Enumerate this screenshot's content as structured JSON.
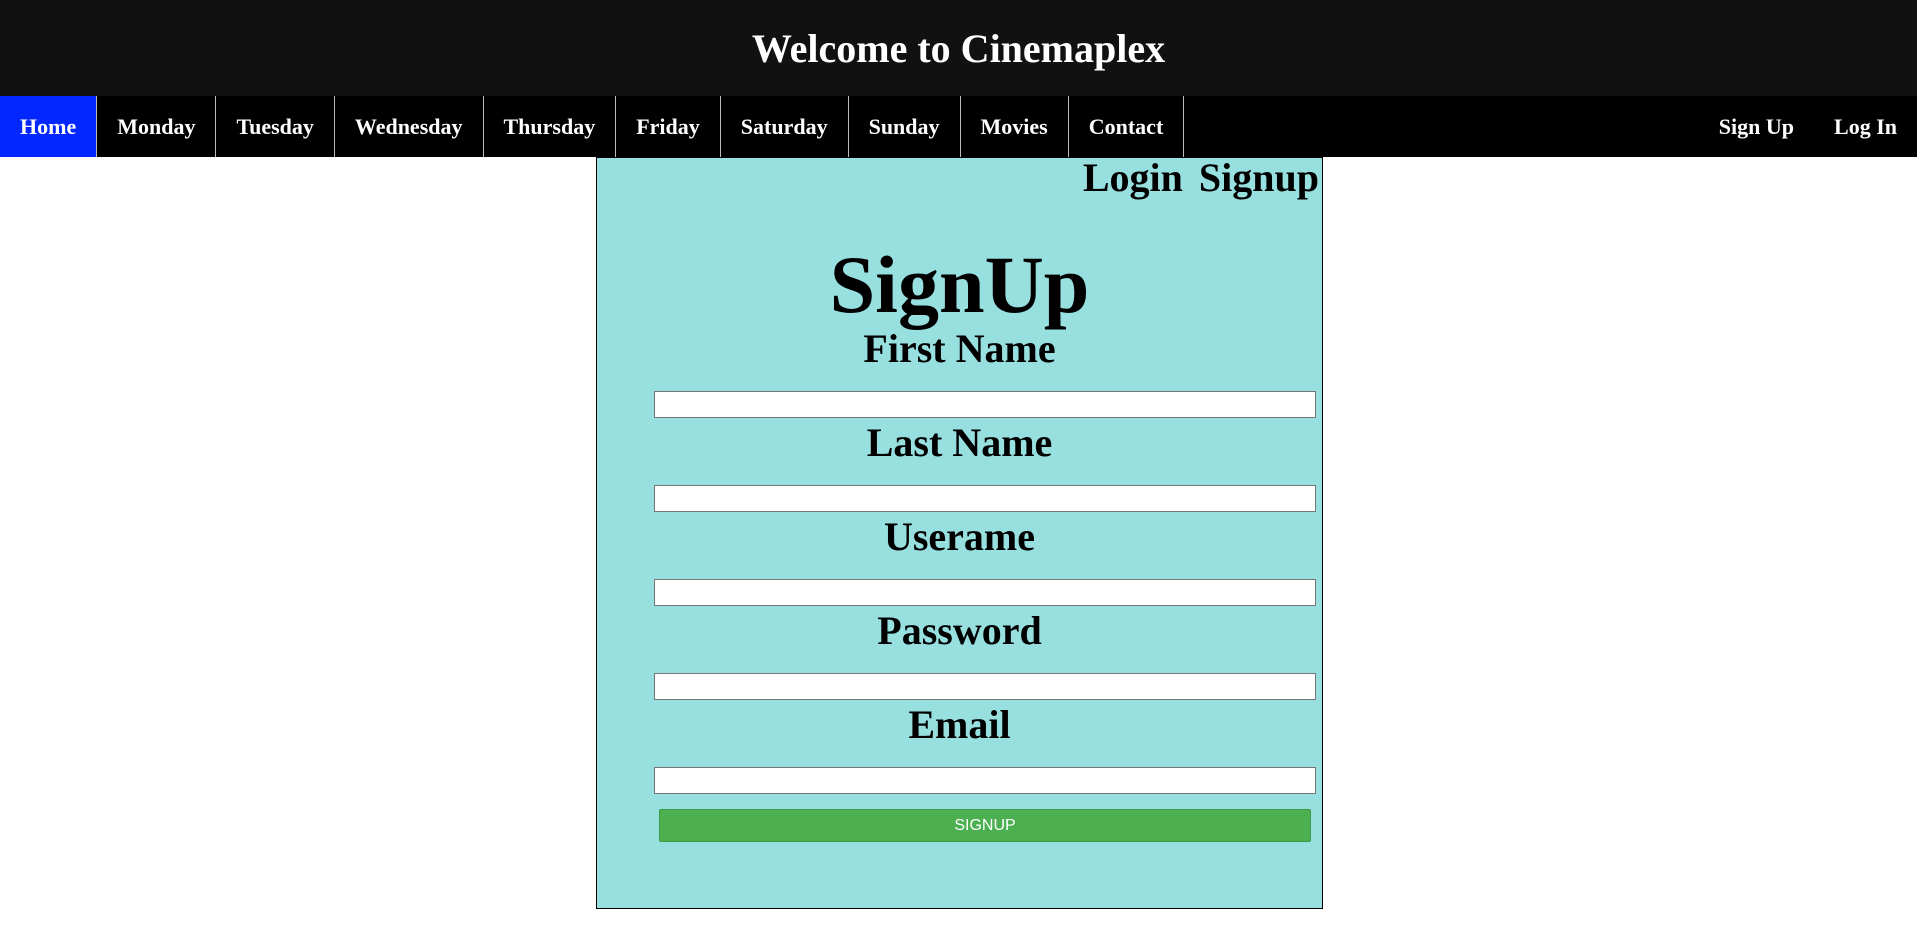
{
  "header": {
    "title": "Welcome to Cinemaplex"
  },
  "nav": {
    "left_items": [
      {
        "label": "Home",
        "active": true
      },
      {
        "label": "Monday"
      },
      {
        "label": "Tuesday"
      },
      {
        "label": "Wednesday"
      },
      {
        "label": "Thursday"
      },
      {
        "label": "Friday"
      },
      {
        "label": "Saturday"
      },
      {
        "label": "Sunday"
      },
      {
        "label": "Movies"
      },
      {
        "label": "Contact"
      }
    ],
    "right_items": [
      {
        "label": "Sign Up"
      },
      {
        "label": "Log In"
      }
    ],
    "active_color": "#0328ff"
  },
  "panel": {
    "tabs": [
      "Login",
      "Signup"
    ],
    "heading": "SignUp",
    "background": "#98e0e0",
    "fields": [
      {
        "label": "First Name",
        "value": ""
      },
      {
        "label": "Last Name",
        "value": ""
      },
      {
        "label": "Userame",
        "value": ""
      },
      {
        "label": "Password",
        "value": ""
      },
      {
        "label": "Email",
        "value": ""
      }
    ],
    "submit_label": "SIGNUP",
    "submit_color": "#4caf50"
  }
}
